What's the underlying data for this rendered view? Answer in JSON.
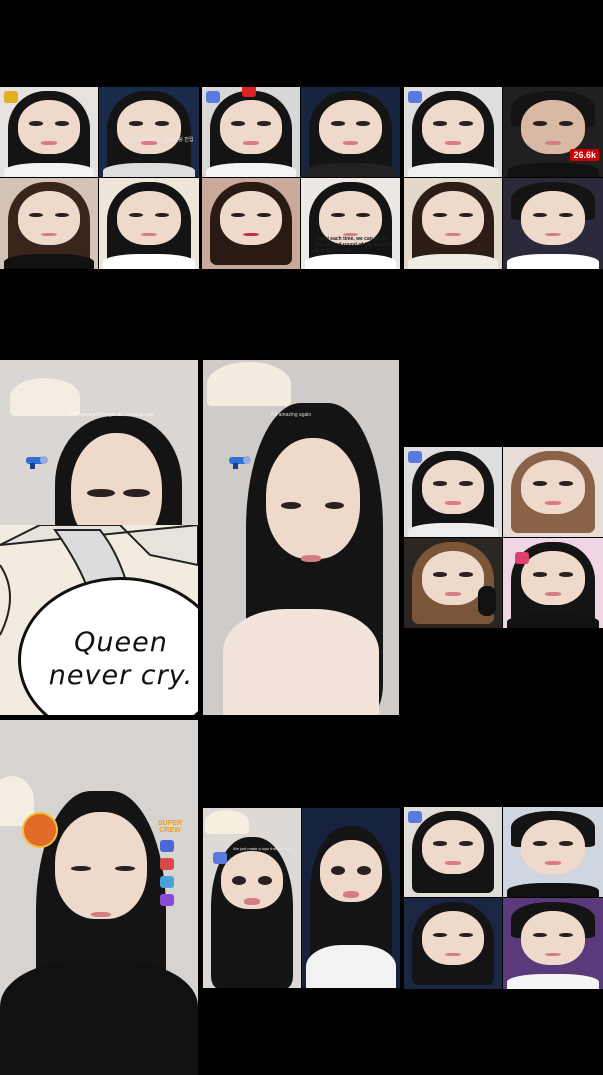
{
  "viewer_badge": "26.6k",
  "captions": {
    "korean_status": "장 터치 ALT터 - 65K 배팅 진입",
    "subtitle_overlay": "Ganai each time, we can go to the second round of the second play to survive.",
    "question_line": "Oh how much longer do I have to wait",
    "repeat_line": "It's amazing again",
    "small_note": "We just made a toys that you can"
  },
  "comic": {
    "speech_text_line1": "Queen",
    "speech_text_line2": "never cry."
  },
  "sticker_label": "SUPER CREW",
  "colors": {
    "background": "#000000",
    "badge_red": "#cc0000",
    "hair": "#141414",
    "skin": "#efd9cb"
  }
}
